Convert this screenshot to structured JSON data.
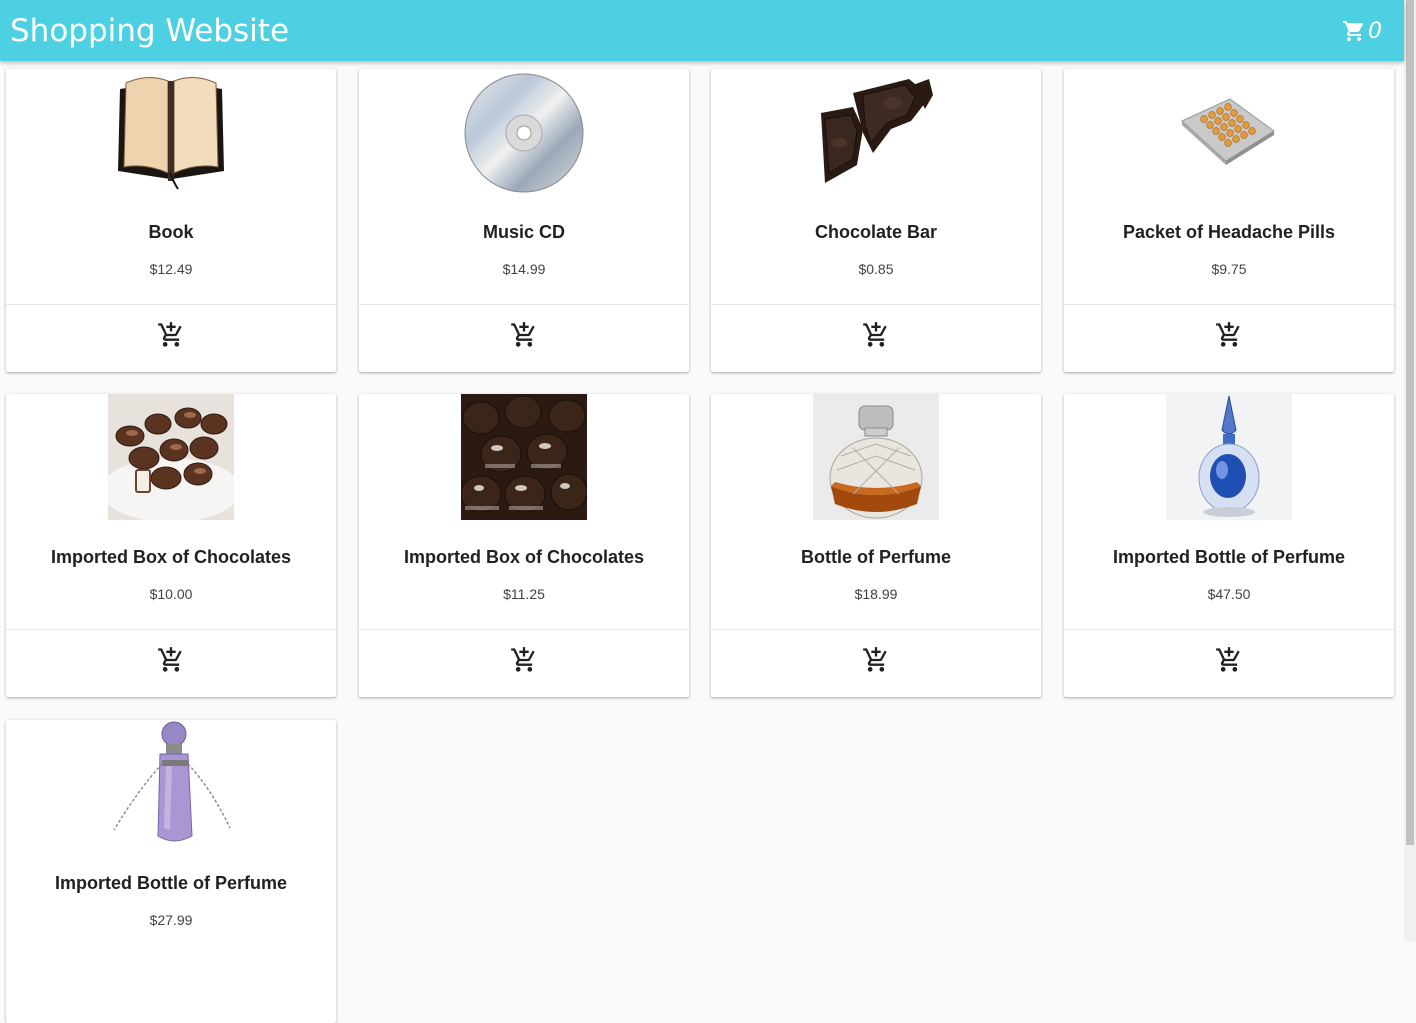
{
  "app": {
    "title": "Shopping Website",
    "cart_count": "0"
  },
  "products": [
    {
      "name": "Book",
      "price": "$12.49",
      "image": "book"
    },
    {
      "name": "Music CD",
      "price": "$14.99",
      "image": "cd"
    },
    {
      "name": "Chocolate Bar",
      "price": "$0.85",
      "image": "chocolate-bar"
    },
    {
      "name": "Packet of Headache Pills",
      "price": "$9.75",
      "image": "pills"
    },
    {
      "name": "Imported Box of Chocolates",
      "price": "$10.00",
      "image": "chocolates-plate"
    },
    {
      "name": "Imported Box of Chocolates",
      "price": "$11.25",
      "image": "chocolate-truffles"
    },
    {
      "name": "Bottle of Perfume",
      "price": "$18.99",
      "image": "perfume-bottle"
    },
    {
      "name": "Imported Bottle of Perfume",
      "price": "$47.50",
      "image": "blue-perfume-bottle"
    },
    {
      "name": "Imported Bottle of Perfume",
      "price": "$27.99",
      "image": "amethyst-perfume-bottle"
    }
  ],
  "colors": {
    "appbar": "#4dd0e1",
    "card": "#ffffff",
    "background": "#fafafa"
  },
  "icons": {
    "cart": "shopping-cart-icon",
    "add": "add-shopping-cart-icon"
  }
}
